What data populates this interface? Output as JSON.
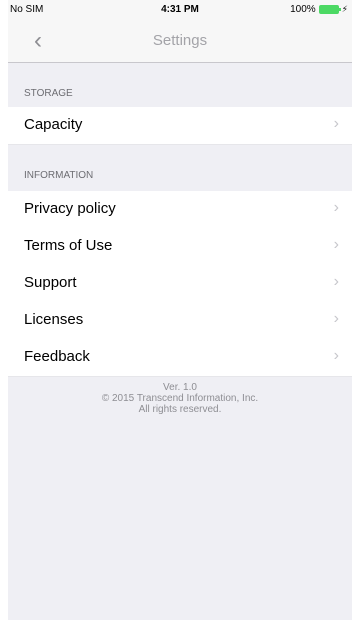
{
  "status_bar": {
    "carrier": "No SIM",
    "time": "4:31 PM",
    "battery": "100%",
    "battery_color": "#4cd964"
  },
  "nav": {
    "back_icon": "chevron-left-icon",
    "title": "Settings"
  },
  "sections": [
    {
      "header": "STORAGE",
      "items": [
        {
          "label": "Capacity"
        }
      ]
    },
    {
      "header": "INFORMATION",
      "items": [
        {
          "label": "Privacy policy"
        },
        {
          "label": "Terms of Use"
        },
        {
          "label": "Support"
        },
        {
          "label": "Licenses"
        },
        {
          "label": "Feedback"
        }
      ]
    }
  ],
  "footer": {
    "version": "Ver. 1.0",
    "copyright": "© 2015 Transcend Information, Inc.",
    "rights": "All rights reserved."
  },
  "colors": {
    "background": "#efeff4",
    "chevron": "#c7c7cc",
    "section_text": "#6d6d72"
  }
}
